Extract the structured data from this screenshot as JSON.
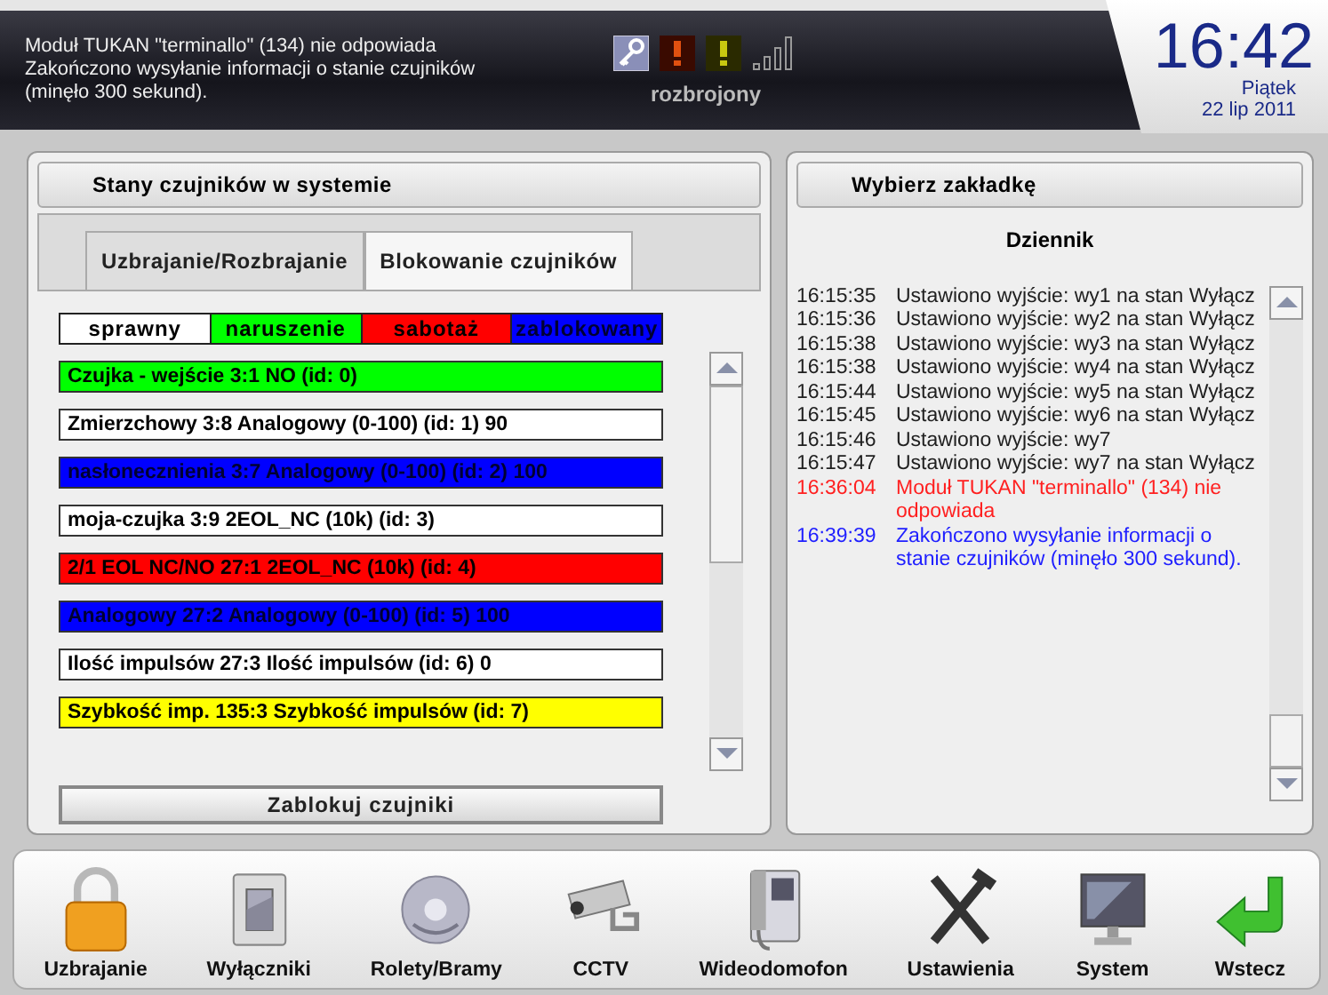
{
  "header": {
    "messages": [
      "Moduł TUKAN \"terminallo\" (134) nie odpowiada",
      "Zakończono wysyłanie informacji o stanie czujników",
      "(minęło 300 sekund)."
    ],
    "system_state": "rozbrojony",
    "clock": {
      "time": "16:42",
      "weekday": "Piątek",
      "date": "22 lip 2011"
    }
  },
  "left_panel": {
    "title": "Stany czujników w systemie",
    "tabs": [
      {
        "label": "Uzbrajanie/Rozbrajanie",
        "selected": false
      },
      {
        "label": "Blokowanie czujników",
        "selected": true
      }
    ],
    "legend": [
      {
        "label": "sprawny",
        "color": "#ffffff"
      },
      {
        "label": "naruszenie",
        "color": "#00ff00"
      },
      {
        "label": "sabotaż",
        "color": "#ff0000"
      },
      {
        "label": "zablokowany",
        "color": "#0000ff"
      }
    ],
    "sensors": [
      {
        "label": "Czujka - wejście 3:1 NO (id: 0)",
        "color": "#00ff00"
      },
      {
        "label": "Zmierzchowy 3:8 Analogowy (0-100) (id: 1) 90",
        "color": "#ffffff"
      },
      {
        "label": "nasłonecznienia 3:7 Analogowy (0-100) (id: 2) 100",
        "color": "#0000ff"
      },
      {
        "label": "moja-czujka 3:9 2EOL_NC (10k) (id: 3)",
        "color": "#ffffff"
      },
      {
        "label": "2/1 EOL NC/NO 27:1 2EOL_NC (10k) (id: 4)",
        "color": "#ff0000"
      },
      {
        "label": "Analogowy 27:2 Analogowy (0-100) (id: 5) 100",
        "color": "#0000ff"
      },
      {
        "label": "Ilość impulsów 27:3 Ilość impulsów (id: 6) 0",
        "color": "#ffffff"
      },
      {
        "label": "Szybkość imp. 135:3 Szybkość impulsów (id: 7)",
        "color": "#ffff00"
      }
    ],
    "button": "Zablokuj czujniki"
  },
  "right_panel": {
    "title": "Wybierz zakładkę",
    "subtitle": "Dziennik",
    "log": [
      {
        "time": "16:15:35",
        "text": "Ustawiono wyjście: wy1 na stan Wyłącz",
        "color": "#202020"
      },
      {
        "time": "16:15:36",
        "text": "Ustawiono wyjście: wy2 na stan Wyłącz",
        "color": "#202020"
      },
      {
        "time": "16:15:38",
        "text": "Ustawiono wyjście: wy3 na stan Wyłącz",
        "color": "#202020"
      },
      {
        "time": "16:15:38",
        "text": "Ustawiono wyjście: wy4 na stan Wyłącz",
        "color": "#202020"
      },
      {
        "time": "16:15:44",
        "text": "Ustawiono wyjście: wy5 na stan Wyłącz",
        "color": "#202020"
      },
      {
        "time": "16:15:45",
        "text": "Ustawiono wyjście: wy6 na stan Wyłącz",
        "color": "#202020"
      },
      {
        "time": "16:15:46",
        "text": "Ustawiono wyjście: wy7",
        "color": "#202020"
      },
      {
        "time": "16:15:47",
        "text": "Ustawiono wyjście: wy7 na stan Wyłącz",
        "color": "#202020"
      },
      {
        "time": "16:36:04",
        "text": "Moduł TUKAN \"terminallo\" (134) nie odpowiada",
        "color": "#ff2020"
      },
      {
        "time": "16:39:39",
        "text": "Zakończono wysyłanie informacji o stanie czujników (minęło 300 sekund).",
        "color": "#2020ff"
      }
    ]
  },
  "dock": [
    {
      "kind": "lock",
      "label": "Uzbrajanie"
    },
    {
      "kind": "switch",
      "label": "Wyłączniki"
    },
    {
      "kind": "disc",
      "label": "Rolety/Bramy"
    },
    {
      "kind": "camera",
      "label": "CCTV"
    },
    {
      "kind": "intercom",
      "label": "Wideodomofon"
    },
    {
      "kind": "tools",
      "label": "Ustawienia"
    },
    {
      "kind": "monitor",
      "label": "System"
    },
    {
      "kind": "back",
      "label": "Wstecz"
    }
  ]
}
